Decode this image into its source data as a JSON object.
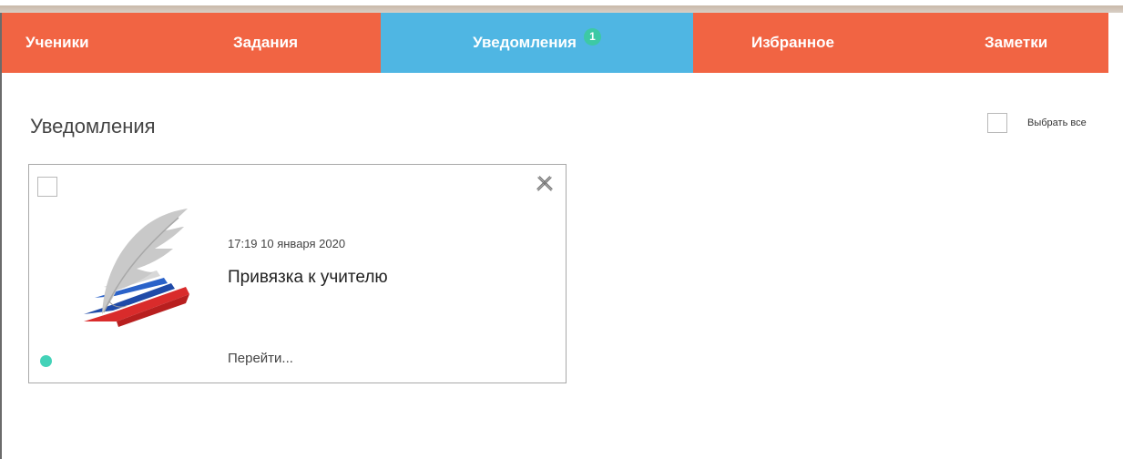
{
  "nav": {
    "tabs": [
      {
        "label": "Ученики"
      },
      {
        "label": "Задания"
      },
      {
        "label": "Уведомления",
        "badge": "1",
        "active": true
      },
      {
        "label": "Избранное"
      },
      {
        "label": "Заметки"
      }
    ]
  },
  "main": {
    "title": "Уведомления",
    "select_all_label": "Выбрать все"
  },
  "notification": {
    "time": "17:19 10 января 2020",
    "title": "Привязка к учителю",
    "link": "Перейти...",
    "status": "unread"
  },
  "colors": {
    "nav_bg": "#f16443",
    "nav_active": "#4fb6e3",
    "badge": "#3dc9a5",
    "status_dot": "#43d2b8"
  },
  "icons": {
    "close": "close-icon",
    "logo": "feather-book-logo"
  }
}
